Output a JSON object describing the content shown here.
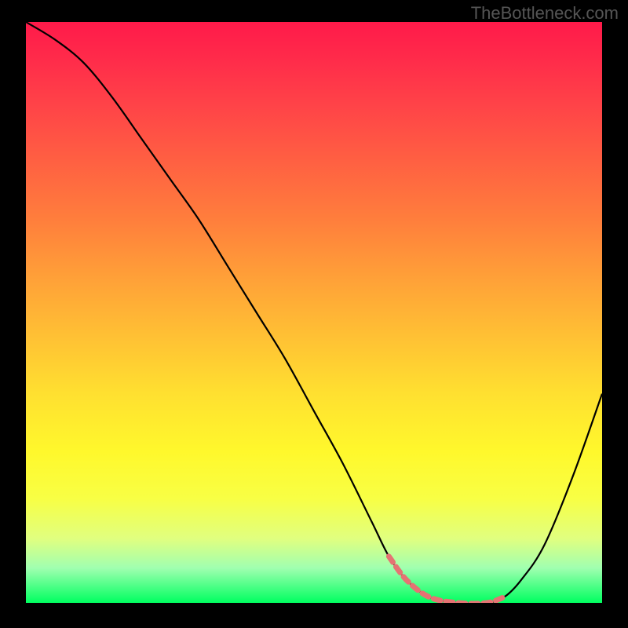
{
  "watermark": "TheBottleneck.com",
  "chart_data": {
    "type": "line",
    "title": "",
    "xlabel": "",
    "ylabel": "",
    "xlim": [
      0,
      100
    ],
    "ylim": [
      0,
      100
    ],
    "series": [
      {
        "name": "bottleneck-curve",
        "x": [
          0,
          5,
          10,
          15,
          20,
          25,
          30,
          35,
          40,
          45,
          50,
          55,
          60,
          63,
          66,
          70,
          75,
          80,
          83,
          86,
          90,
          95,
          100
        ],
        "values": [
          100,
          97,
          93,
          87,
          80,
          73,
          66,
          58,
          50,
          42,
          33,
          24,
          14,
          8,
          4,
          1,
          0,
          0,
          1,
          4,
          10,
          22,
          36
        ]
      },
      {
        "name": "highlight-band",
        "x": [
          63,
          66,
          70,
          75,
          80,
          83
        ],
        "values": [
          8,
          4,
          1,
          0,
          0,
          1
        ]
      }
    ],
    "gradient_stops": [
      {
        "pos": 0,
        "color": "#ff1a4a"
      },
      {
        "pos": 50,
        "color": "#ffc034"
      },
      {
        "pos": 80,
        "color": "#fff82c"
      },
      {
        "pos": 100,
        "color": "#00ff60"
      }
    ]
  }
}
